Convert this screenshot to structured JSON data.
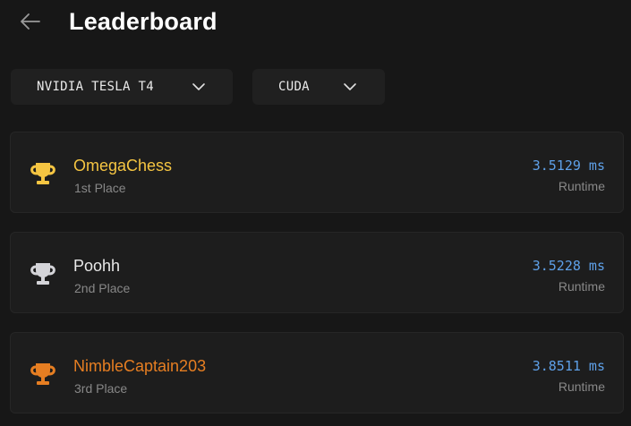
{
  "header": {
    "title": "Leaderboard",
    "back_icon": "arrow-left-icon"
  },
  "filters": {
    "gpu": {
      "selected": "NVIDIA TESLA T4",
      "icon": "chevron-down-icon"
    },
    "language": {
      "selected": "CUDA",
      "icon": "chevron-down-icon"
    }
  },
  "entries": [
    {
      "name": "OmegaChess",
      "place": "1st Place",
      "runtime": "3.5129 ms",
      "runtime_label": "Runtime",
      "icon": "trophy-icon",
      "color": "#f5c542"
    },
    {
      "name": "Poohh",
      "place": "2nd Place",
      "runtime": "3.5228 ms",
      "runtime_label": "Runtime",
      "icon": "trophy-icon",
      "color": "#d4d4d8"
    },
    {
      "name": "NimbleCaptain203",
      "place": "3rd Place",
      "runtime": "3.8511 ms",
      "runtime_label": "Runtime",
      "icon": "trophy-icon",
      "color": "#e67e22"
    }
  ],
  "colors": {
    "background": "#171717",
    "card": "#1d1d1d",
    "runtime": "#5ea0e8",
    "gold": "#f5c542",
    "silver": "#d4d4d8",
    "bronze": "#e67e22"
  }
}
